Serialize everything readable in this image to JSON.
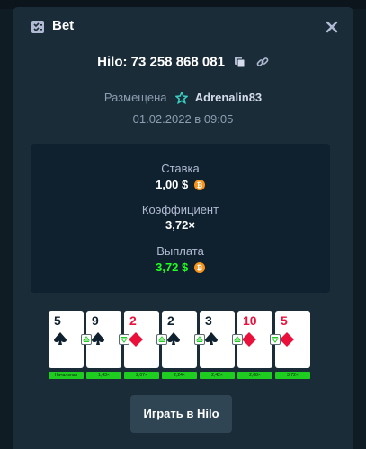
{
  "header": {
    "title": "Bet",
    "icon": "clipboard-icon",
    "close_icon": "close-icon"
  },
  "bet": {
    "id": "Hilo: 73 258 868 081"
  },
  "placed": {
    "label": "Размещена",
    "user": "Adrenalin83",
    "date": "01.02.2022 в 09:05"
  },
  "stats": {
    "wager_label": "Ставка",
    "wager_value": "1,00 $",
    "multiplier_label": "Коэффициент",
    "multiplier_value": "3,72×",
    "payout_label": "Выплата",
    "payout_value": "3,72 $"
  },
  "cards": [
    {
      "rank": "5",
      "suit": "spade",
      "color": "black",
      "prediction": null,
      "multiplier": "Начальная"
    },
    {
      "rank": "9",
      "suit": "spade",
      "color": "black",
      "prediction": "higher",
      "multiplier": "1,43×"
    },
    {
      "rank": "2",
      "suit": "diamond",
      "color": "red",
      "prediction": "lower",
      "multiplier": "2,07×"
    },
    {
      "rank": "2",
      "suit": "spade",
      "color": "black",
      "prediction": "higher",
      "multiplier": "2,24×"
    },
    {
      "rank": "3",
      "suit": "spade",
      "color": "black",
      "prediction": "higher",
      "multiplier": "2,42×"
    },
    {
      "rank": "10",
      "suit": "diamond",
      "color": "red",
      "prediction": "higher",
      "multiplier": "2,88×"
    },
    {
      "rank": "5",
      "suit": "diamond",
      "color": "red",
      "prediction": "lower",
      "multiplier": "3,72×"
    }
  ],
  "actions": {
    "play_label": "Играть в Hilo"
  },
  "colors": {
    "accent_green": "#1fff20",
    "card_red": "#e9113c",
    "modal_bg": "#1a2c38",
    "panel_bg": "#0f212e"
  }
}
